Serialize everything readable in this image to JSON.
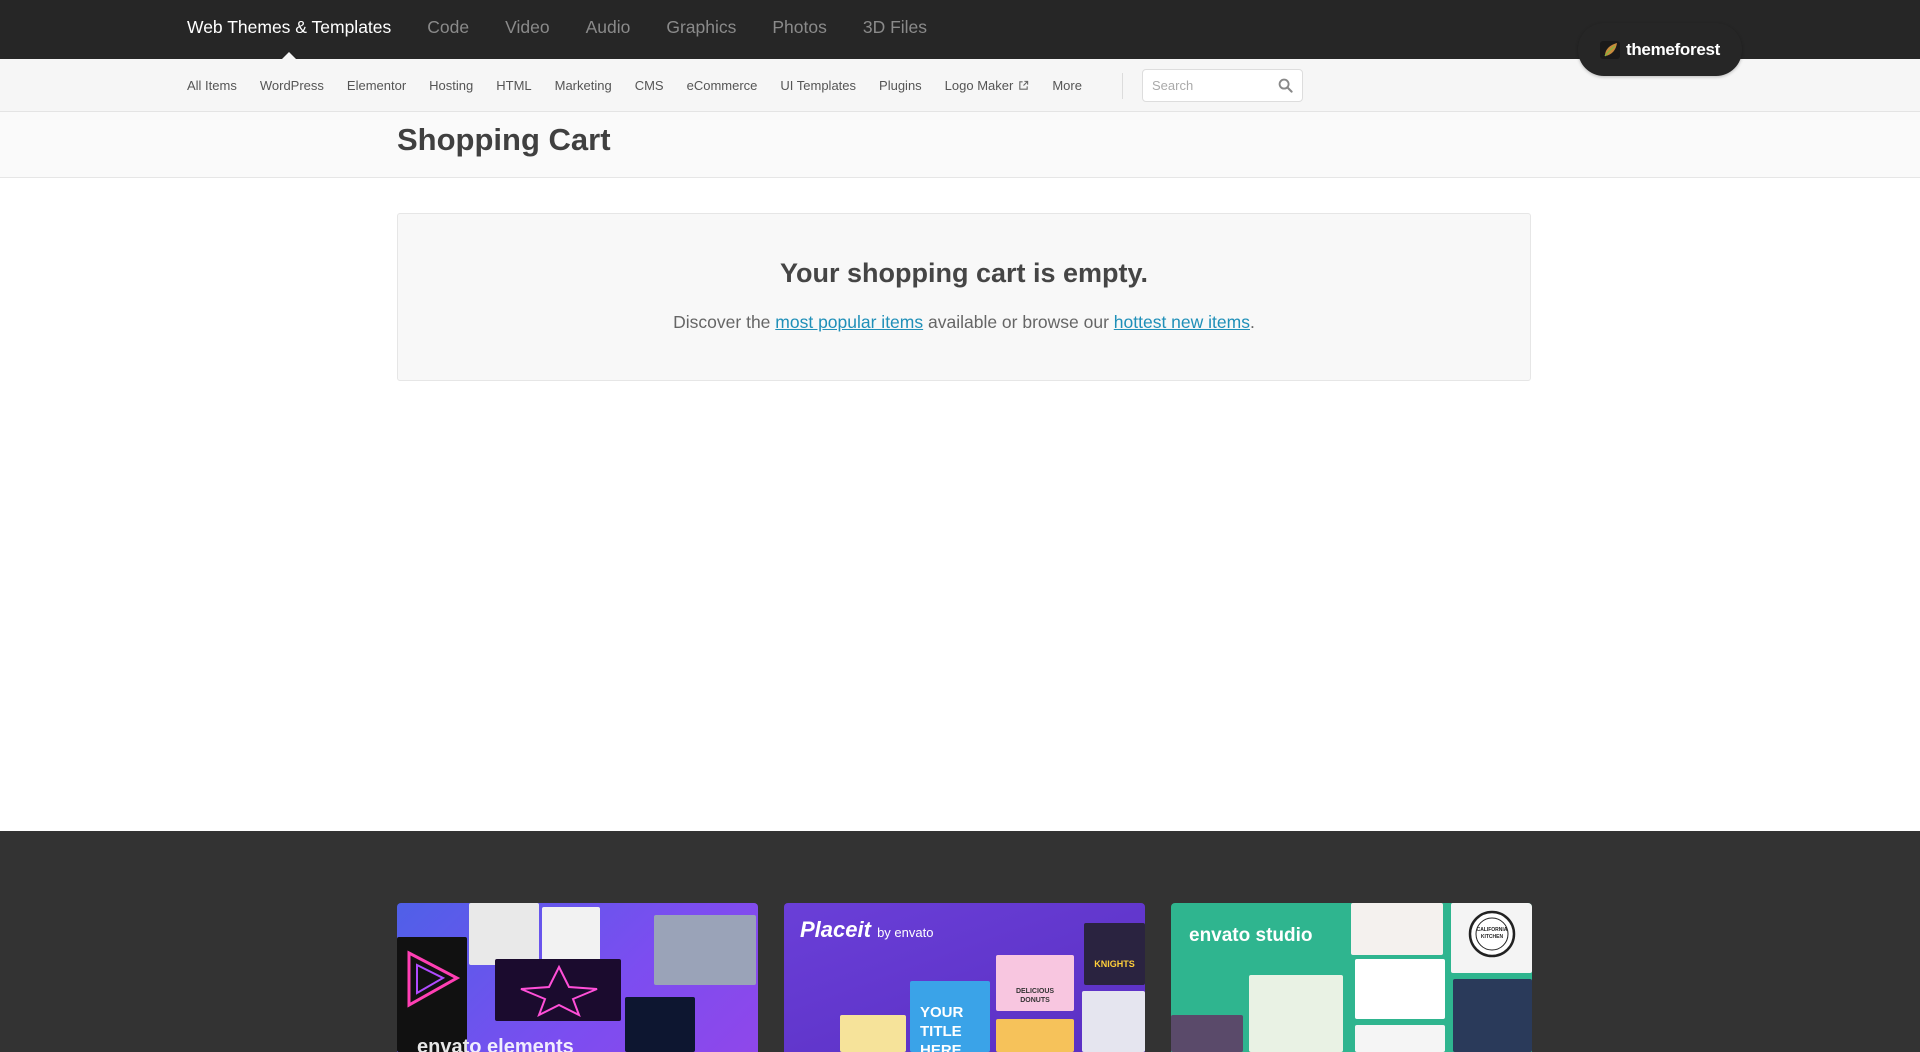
{
  "top_nav": {
    "categories": [
      {
        "label": "Web Themes & Templates",
        "active": true
      },
      {
        "label": "Code"
      },
      {
        "label": "Video"
      },
      {
        "label": "Audio"
      },
      {
        "label": "Graphics"
      },
      {
        "label": "Photos"
      },
      {
        "label": "3D Files"
      }
    ],
    "logo": {
      "text": "themeforest",
      "icon": "themeforest-leaf-icon",
      "accent": "#82b440"
    }
  },
  "sub_nav": {
    "items": [
      {
        "label": "All Items"
      },
      {
        "label": "WordPress"
      },
      {
        "label": "Elementor"
      },
      {
        "label": "Hosting"
      },
      {
        "label": "HTML"
      },
      {
        "label": "Marketing"
      },
      {
        "label": "CMS"
      },
      {
        "label": "eCommerce"
      },
      {
        "label": "UI Templates"
      },
      {
        "label": "Plugins"
      },
      {
        "label": "Logo Maker",
        "icon": "external-link-icon"
      },
      {
        "label": "More"
      }
    ],
    "search": {
      "placeholder": "Search",
      "value": "",
      "icon": "search-icon"
    }
  },
  "page": {
    "title": "Shopping Cart"
  },
  "cart": {
    "empty_title": "Your shopping cart is empty.",
    "text_before": "Discover the ",
    "link_popular": "most popular items",
    "text_middle": " available or browse our ",
    "link_hottest": "hottest new items",
    "text_after": ".",
    "link_color": "#1f8fb8"
  },
  "footer": {
    "promos": [
      {
        "name": "envato elements",
        "text": "envato elements"
      },
      {
        "name": "Placeit by envato",
        "text": "Placeit",
        "subtext": "by envato",
        "tiles": [
          "KNIGHTS",
          "DELICIOUS DONUTS",
          "YOUR TITLE HERE"
        ]
      },
      {
        "name": "envato studio",
        "text": "envato studio",
        "tiles": [
          "CALIFORNIA KITCHEN"
        ]
      }
    ]
  },
  "colors": {
    "topbar_bg": "#262626",
    "subnav_bg": "#f6f6f6",
    "footer_bg": "#333333",
    "studio_green": "#2fb58f"
  }
}
